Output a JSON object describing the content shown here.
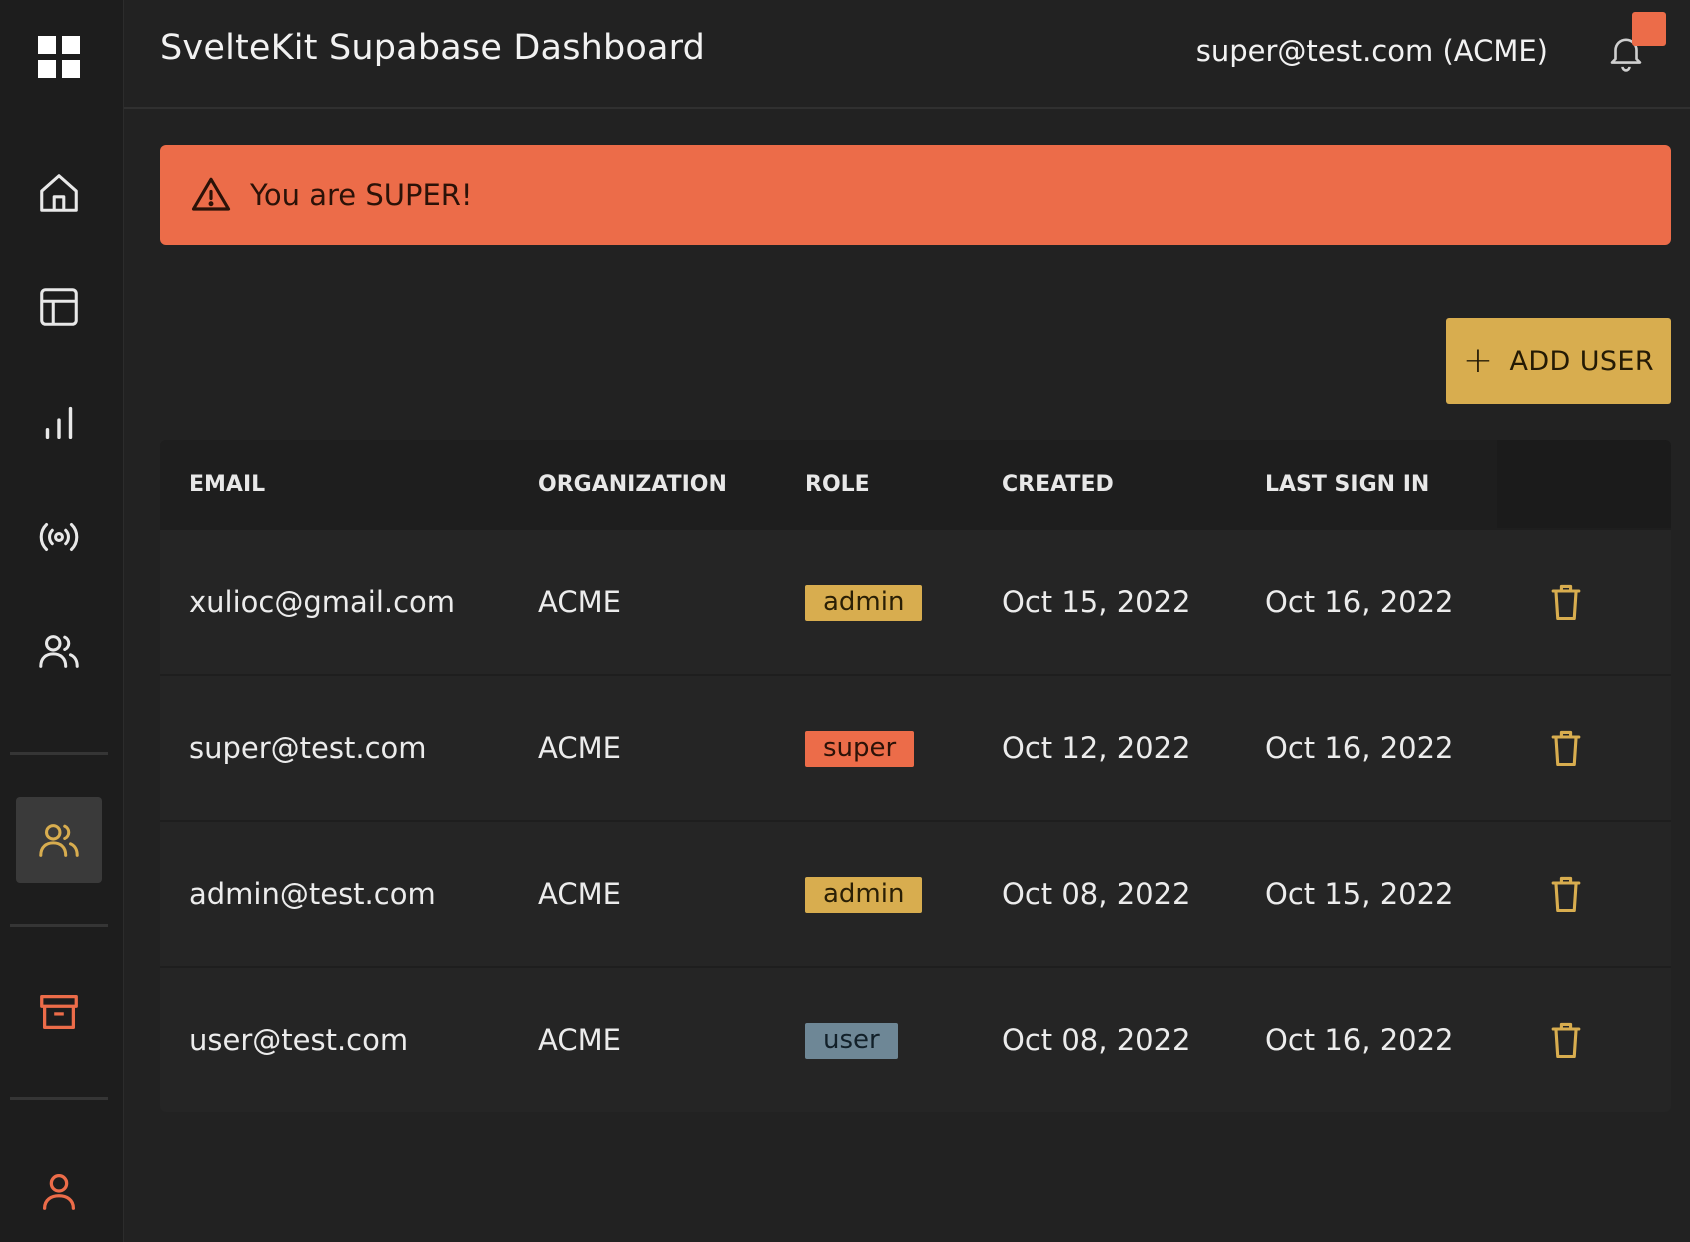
{
  "app": {
    "title": "SvelteKit Supabase Dashboard"
  },
  "header": {
    "user_label": "super@test.com (ACME)"
  },
  "sidebar": {
    "items": [
      {
        "name": "apps-grid-icon"
      },
      {
        "name": "home-icon"
      },
      {
        "name": "layout-icon"
      },
      {
        "name": "chart-bars-icon"
      },
      {
        "name": "broadcast-icon"
      },
      {
        "name": "users-icon"
      },
      {
        "name": "users-admin-icon",
        "active": true
      },
      {
        "name": "archive-icon"
      },
      {
        "name": "user-profile-icon"
      }
    ],
    "accent": "#ec6c49",
    "highlight": "#d8ad4f"
  },
  "alert": {
    "text": "You are SUPER!",
    "color": "#ec6c49"
  },
  "toolbar": {
    "add_user_label": "ADD USER",
    "add_user_color": "#d8ad4f"
  },
  "table": {
    "headers": {
      "email": "EMAIL",
      "organization": "ORGANIZATION",
      "role": "ROLE",
      "created": "CREATED",
      "last_sign_in": "LAST SIGN IN"
    },
    "rows": [
      {
        "email": "xulioc@gmail.com",
        "organization": "ACME",
        "role": "admin",
        "created": "Oct 15, 2022",
        "last_sign_in": "Oct 16, 2022"
      },
      {
        "email": "super@test.com",
        "organization": "ACME",
        "role": "super",
        "created": "Oct 12, 2022",
        "last_sign_in": "Oct 16, 2022"
      },
      {
        "email": "admin@test.com",
        "organization": "ACME",
        "role": "admin",
        "created": "Oct 08, 2022",
        "last_sign_in": "Oct 15, 2022"
      },
      {
        "email": "user@test.com",
        "organization": "ACME",
        "role": "user",
        "created": "Oct 08, 2022",
        "last_sign_in": "Oct 16, 2022"
      }
    ]
  }
}
